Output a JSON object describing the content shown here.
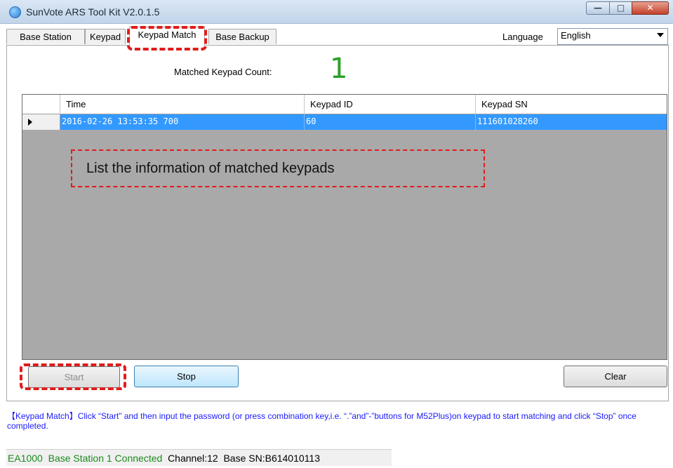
{
  "window": {
    "title": "SunVote ARS Tool Kit  V2.0.1.5",
    "controls": {
      "minimize": "—",
      "maximize": "□",
      "close": "✕"
    }
  },
  "tabs": [
    {
      "label": "Base Station"
    },
    {
      "label": "Keypad"
    },
    {
      "label": "Keypad Match"
    },
    {
      "label": "Base Backup"
    }
  ],
  "language": {
    "label": "Language",
    "selected": "English"
  },
  "match": {
    "count_label": "Matched Keypad Count:",
    "count_value": "1"
  },
  "table": {
    "columns": [
      "Time",
      "Keypad ID",
      "Keypad SN"
    ],
    "rows": [
      {
        "time": "2016-02-26 13:53:35 700",
        "keypad_id": "60",
        "keypad_sn": "111601028260"
      }
    ]
  },
  "annotation": {
    "text": "List the information of matched keypads"
  },
  "buttons": {
    "start": "Start",
    "stop": "Stop",
    "clear": "Clear"
  },
  "info": {
    "text": "【Keypad Match】Click “Start” and then input the password (or press combination key,i.e. “.”and”-”buttons for M52Plus)on keypad to start matching and click “Stop” once completed."
  },
  "status": {
    "device": "EA1000",
    "connection": "Base Station 1 Connected",
    "channel": "Channel:12",
    "base_sn": "Base SN:B614010113"
  },
  "colors": {
    "highlight": "#e01c1c",
    "count": "#2aa02a",
    "selection": "#3399ff",
    "info_text": "#1a1aff",
    "status_ok": "#1a8a1a"
  }
}
